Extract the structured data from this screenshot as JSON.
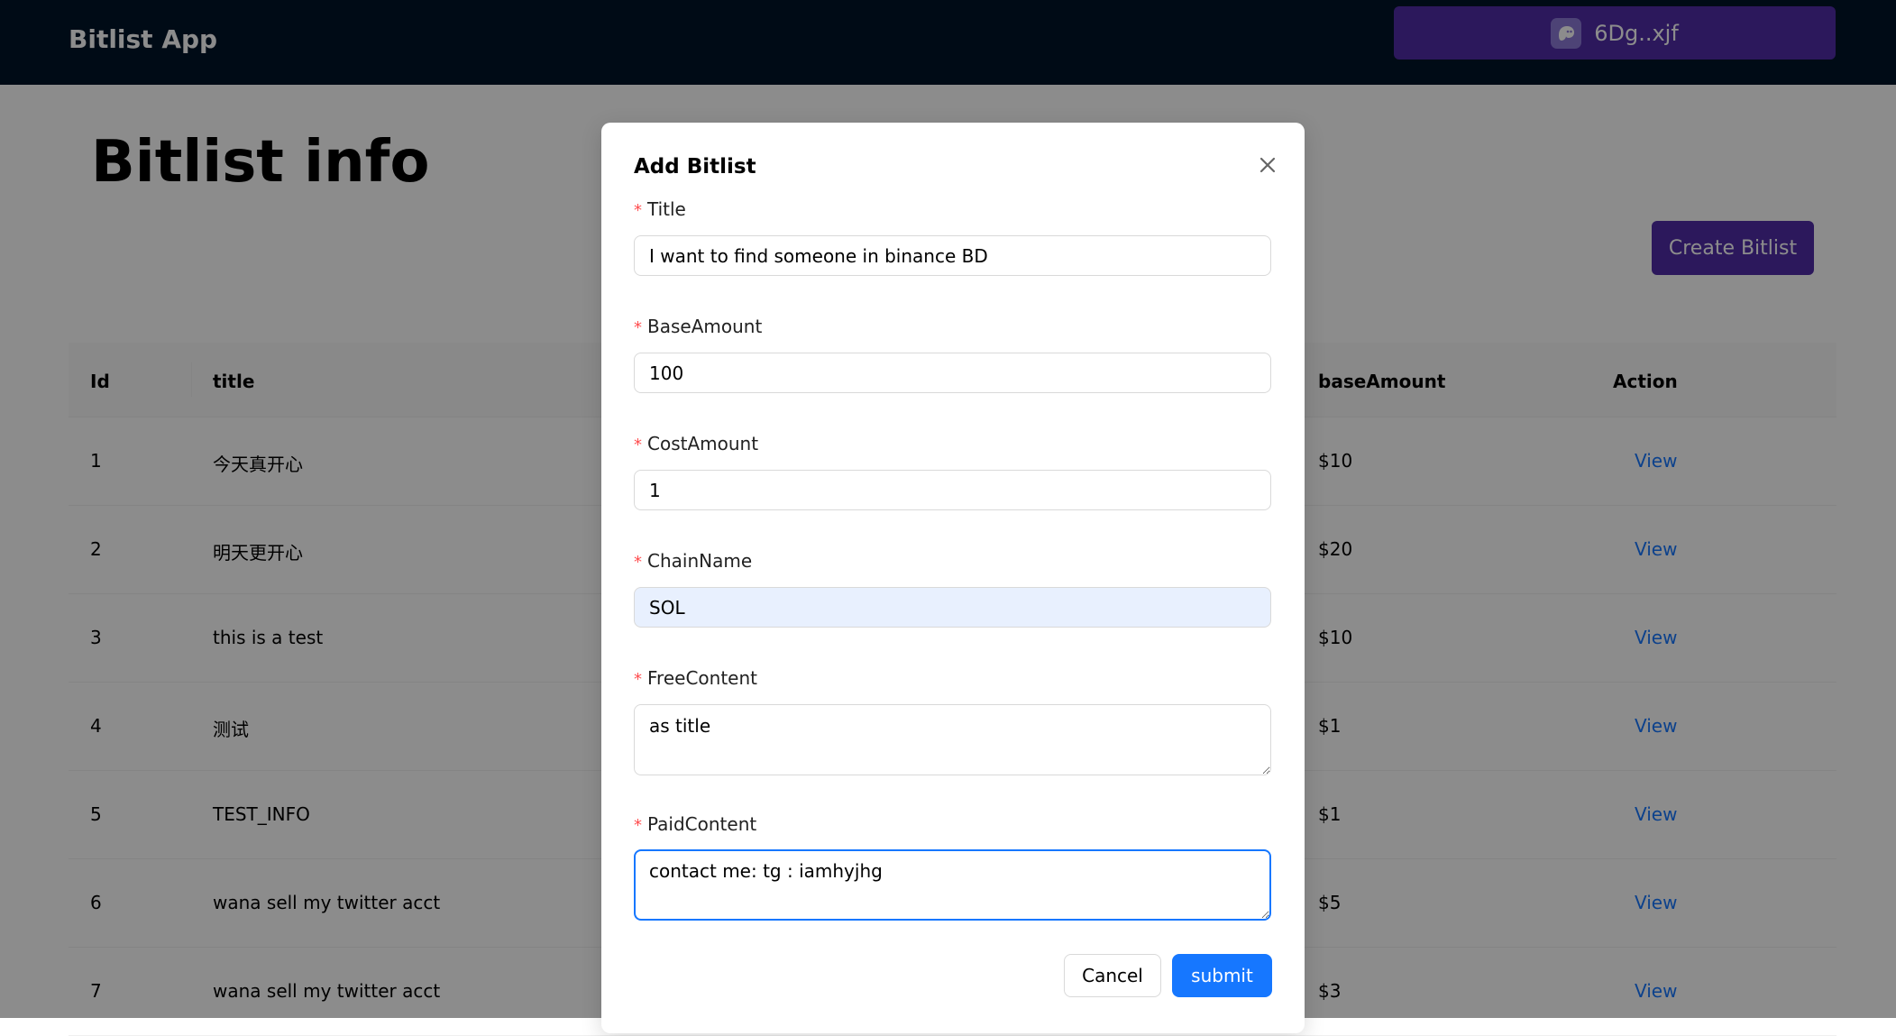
{
  "header": {
    "brand": "Bitlist App",
    "wallet_label": "6Dg..xjf"
  },
  "main": {
    "title": "Bitlist info",
    "create_button": "Create Bitlist",
    "table": {
      "columns": {
        "id": "Id",
        "title": "title",
        "base_amount": "baseAmount",
        "action": "Action"
      },
      "rows": [
        {
          "id": "1",
          "title": "今天真开心",
          "amount": "$10",
          "action": "View"
        },
        {
          "id": "2",
          "title": "明天更开心",
          "amount": "$20",
          "action": "View"
        },
        {
          "id": "3",
          "title": "this is a test",
          "amount": "$10",
          "action": "View"
        },
        {
          "id": "4",
          "title": "测试",
          "amount": "$1",
          "action": "View"
        },
        {
          "id": "5",
          "title": "TEST_INFO",
          "amount": "$1",
          "action": "View"
        },
        {
          "id": "6",
          "title": "wana sell my twitter acct",
          "amount": "$5",
          "action": "View"
        },
        {
          "id": "7",
          "title": "wana sell my twitter acct",
          "amount": "$3",
          "action": "View"
        }
      ]
    }
  },
  "modal": {
    "title": "Add Bitlist",
    "fields": {
      "title": {
        "label": "Title",
        "value": "I want to find someone in binance BD"
      },
      "base_amount": {
        "label": "BaseAmount",
        "value": "100"
      },
      "cost_amount": {
        "label": "CostAmount",
        "value": "1"
      },
      "chain_name": {
        "label": "ChainName",
        "value": "SOL"
      },
      "free_content": {
        "label": "FreeContent",
        "value": "as title"
      },
      "paid_content": {
        "label": "PaidContent",
        "value": "contact me: tg : iamhyjhg"
      }
    },
    "cancel_label": "Cancel",
    "submit_label": "submit"
  },
  "colors": {
    "header_bg": "#001529",
    "brand_purple": "#512da8",
    "primary_blue": "#1677ff",
    "required_red": "#ff4d4f"
  }
}
